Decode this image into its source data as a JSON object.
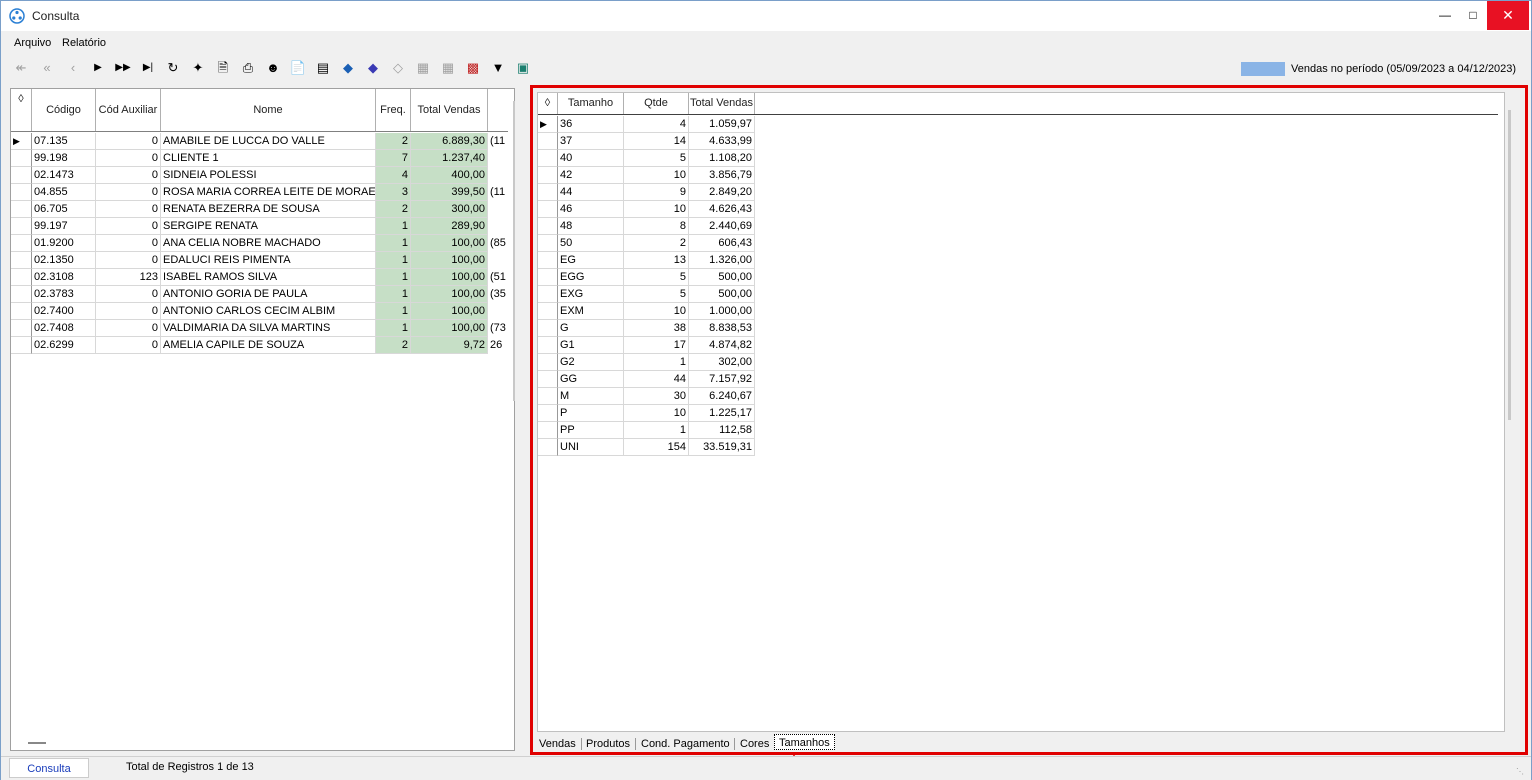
{
  "window": {
    "title": "Consulta"
  },
  "menu": {
    "arquivo": "Arquivo",
    "relatorio": "Relatório"
  },
  "legend": {
    "label": "Vendas no período (05/09/2023 a 04/12/2023)",
    "color": "#8ab4e6"
  },
  "left_grid": {
    "headers": [
      "Código",
      "Cód Auxiliar",
      "Nome",
      "Freq.",
      "Total Vendas"
    ],
    "rows": [
      [
        "07.135",
        "0",
        "AMABILE DE LUCCA DO VALLE",
        "2",
        "6.889,30",
        "(11"
      ],
      [
        "99.198",
        "0",
        "CLIENTE 1",
        "7",
        "1.237,40",
        ""
      ],
      [
        "02.1473",
        "0",
        "SIDNEIA POLESSI",
        "4",
        "400,00",
        ""
      ],
      [
        "04.855",
        "0",
        "ROSA MARIA CORREA LEITE DE MORAES",
        "3",
        "399,50",
        "(11"
      ],
      [
        "06.705",
        "0",
        "RENATA  BEZERRA DE SOUSA",
        "2",
        "300,00",
        ""
      ],
      [
        "99.197",
        "0",
        "SERGIPE RENATA",
        "1",
        "289,90",
        ""
      ],
      [
        "01.9200",
        "0",
        "ANA CELIA NOBRE MACHADO",
        "1",
        "100,00",
        "(85"
      ],
      [
        "02.1350",
        "0",
        "EDALUCI REIS PIMENTA",
        "1",
        "100,00",
        ""
      ],
      [
        "02.3108",
        "123",
        "ISABEL RAMOS SILVA",
        "1",
        "100,00",
        "(51"
      ],
      [
        "02.3783",
        "0",
        "ANTONIO GORIA DE PAULA",
        "1",
        "100,00",
        "(35"
      ],
      [
        "02.7400",
        "0",
        "ANTONIO CARLOS CECIM ALBIM",
        "1",
        "100,00",
        ""
      ],
      [
        "02.7408",
        "0",
        "VALDIMARIA DA SILVA MARTINS",
        "1",
        "100,00",
        "(73"
      ],
      [
        "02.6299",
        "0",
        "AMELIA CAPILE DE SOUZA",
        "2",
        "9,72",
        "26"
      ]
    ]
  },
  "right_grid": {
    "headers": [
      "Tamanho",
      "Qtde",
      "Total Vendas"
    ],
    "rows": [
      [
        "36",
        "4",
        "1.059,97"
      ],
      [
        "37",
        "14",
        "4.633,99"
      ],
      [
        "40",
        "5",
        "1.108,20"
      ],
      [
        "42",
        "10",
        "3.856,79"
      ],
      [
        "44",
        "9",
        "2.849,20"
      ],
      [
        "46",
        "10",
        "4.626,43"
      ],
      [
        "48",
        "8",
        "2.440,69"
      ],
      [
        "50",
        "2",
        "606,43"
      ],
      [
        "EG",
        "13",
        "1.326,00"
      ],
      [
        "EGG",
        "5",
        "500,00"
      ],
      [
        "EXG",
        "5",
        "500,00"
      ],
      [
        "EXM",
        "10",
        "1.000,00"
      ],
      [
        "G",
        "38",
        "8.838,53"
      ],
      [
        "G1",
        "17",
        "4.874,82"
      ],
      [
        "G2",
        "1",
        "302,00"
      ],
      [
        "GG",
        "44",
        "7.157,92"
      ],
      [
        "M",
        "30",
        "6.240,67"
      ],
      [
        "P",
        "10",
        "1.225,17"
      ],
      [
        "PP",
        "1",
        "112,58"
      ],
      [
        "UNI",
        "154",
        "33.519,31"
      ]
    ]
  },
  "tabs": [
    "Vendas",
    "Produtos",
    "Cond. Pagamento",
    "Cores",
    "Tamanhos"
  ],
  "active_tab": "Tamanhos",
  "status": {
    "tab": "Consulta",
    "text": "Total de Registros 1 de 13"
  },
  "highlight_color": "#e00000"
}
